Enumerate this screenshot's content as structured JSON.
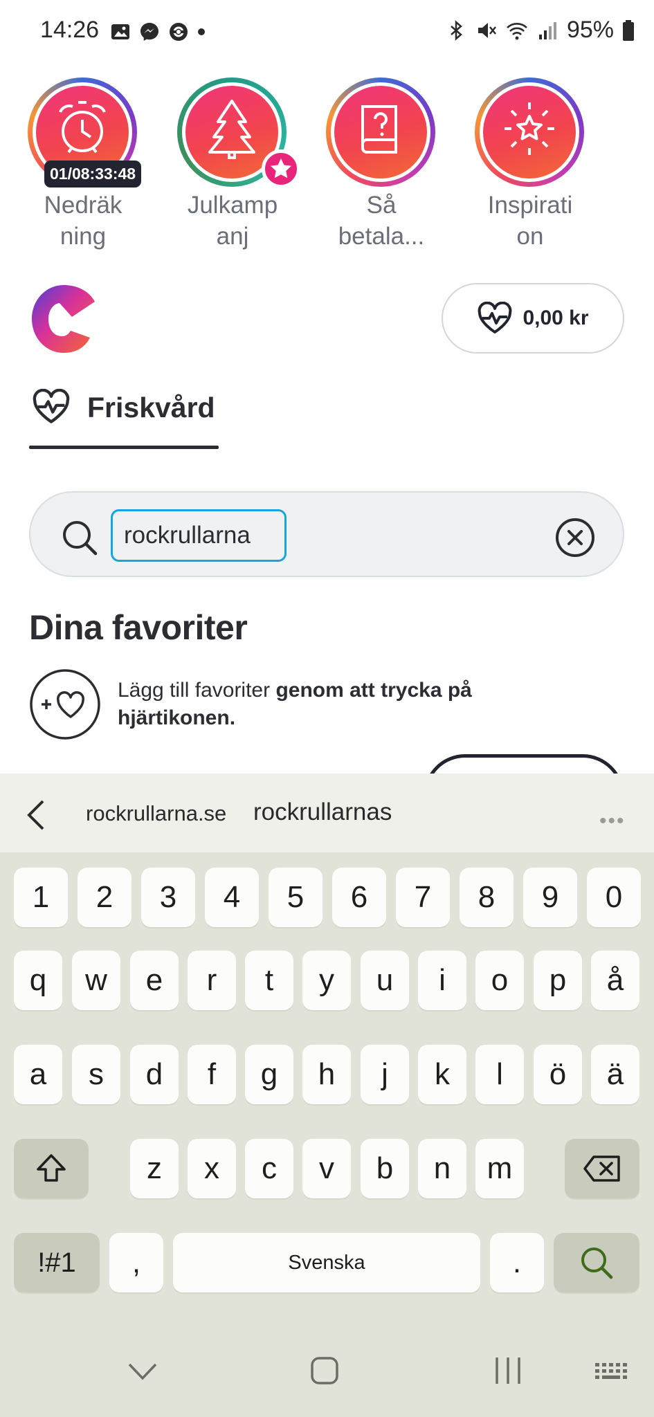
{
  "status_bar": {
    "time": "14:26",
    "battery": "95%",
    "left_icons": [
      "gallery-icon",
      "messenger-icon",
      "sync-icon",
      "dot-icon"
    ],
    "right_icons": [
      "bluetooth-icon",
      "mute-icon",
      "wifi-icon",
      "signal-icon",
      "battery-icon"
    ]
  },
  "stories": [
    {
      "label_line1": "Nedräk",
      "label_line2": "ning",
      "icon": "alarm-clock-icon",
      "timer": "01/08:33:48"
    },
    {
      "label_line1": "Julkamp",
      "label_line2": "anj",
      "icon": "christmas-tree-icon"
    },
    {
      "label_line1": "Så",
      "label_line2": "betala...",
      "icon": "question-book-icon"
    },
    {
      "label_line1": "Inspirati",
      "label_line2": "on",
      "icon": "sparkle-star-icon"
    }
  ],
  "balance": {
    "amount": "0,00 kr",
    "icon": "heart-pulse-icon"
  },
  "tab": {
    "label": "Friskvård",
    "icon": "heart-pulse-icon"
  },
  "search": {
    "value": "rockrullarna"
  },
  "favorites": {
    "title": "Dina favoriter",
    "hint_normal": "Lägg till favoriter ",
    "hint_bold": "genom att trycka på hjärtikonen."
  },
  "keyboard": {
    "suggestions": [
      "rockrullarna.se",
      "rockrullarnas"
    ],
    "more": "•••",
    "row_numbers": [
      "1",
      "2",
      "3",
      "4",
      "5",
      "6",
      "7",
      "8",
      "9",
      "0"
    ],
    "row1": [
      "q",
      "w",
      "e",
      "r",
      "t",
      "y",
      "u",
      "i",
      "o",
      "p",
      "å"
    ],
    "row2": [
      "a",
      "s",
      "d",
      "f",
      "g",
      "h",
      "j",
      "k",
      "l",
      "ö",
      "ä"
    ],
    "row3": [
      "z",
      "x",
      "c",
      "v",
      "b",
      "n",
      "m"
    ],
    "symbols_label": "!#1",
    "comma": ",",
    "space_label": "Svenska",
    "period": "."
  },
  "colors": {
    "accent_blue": "#17a4dd",
    "story_pink": "#f0357c",
    "keyboard_bg": "#e2e3d8"
  }
}
